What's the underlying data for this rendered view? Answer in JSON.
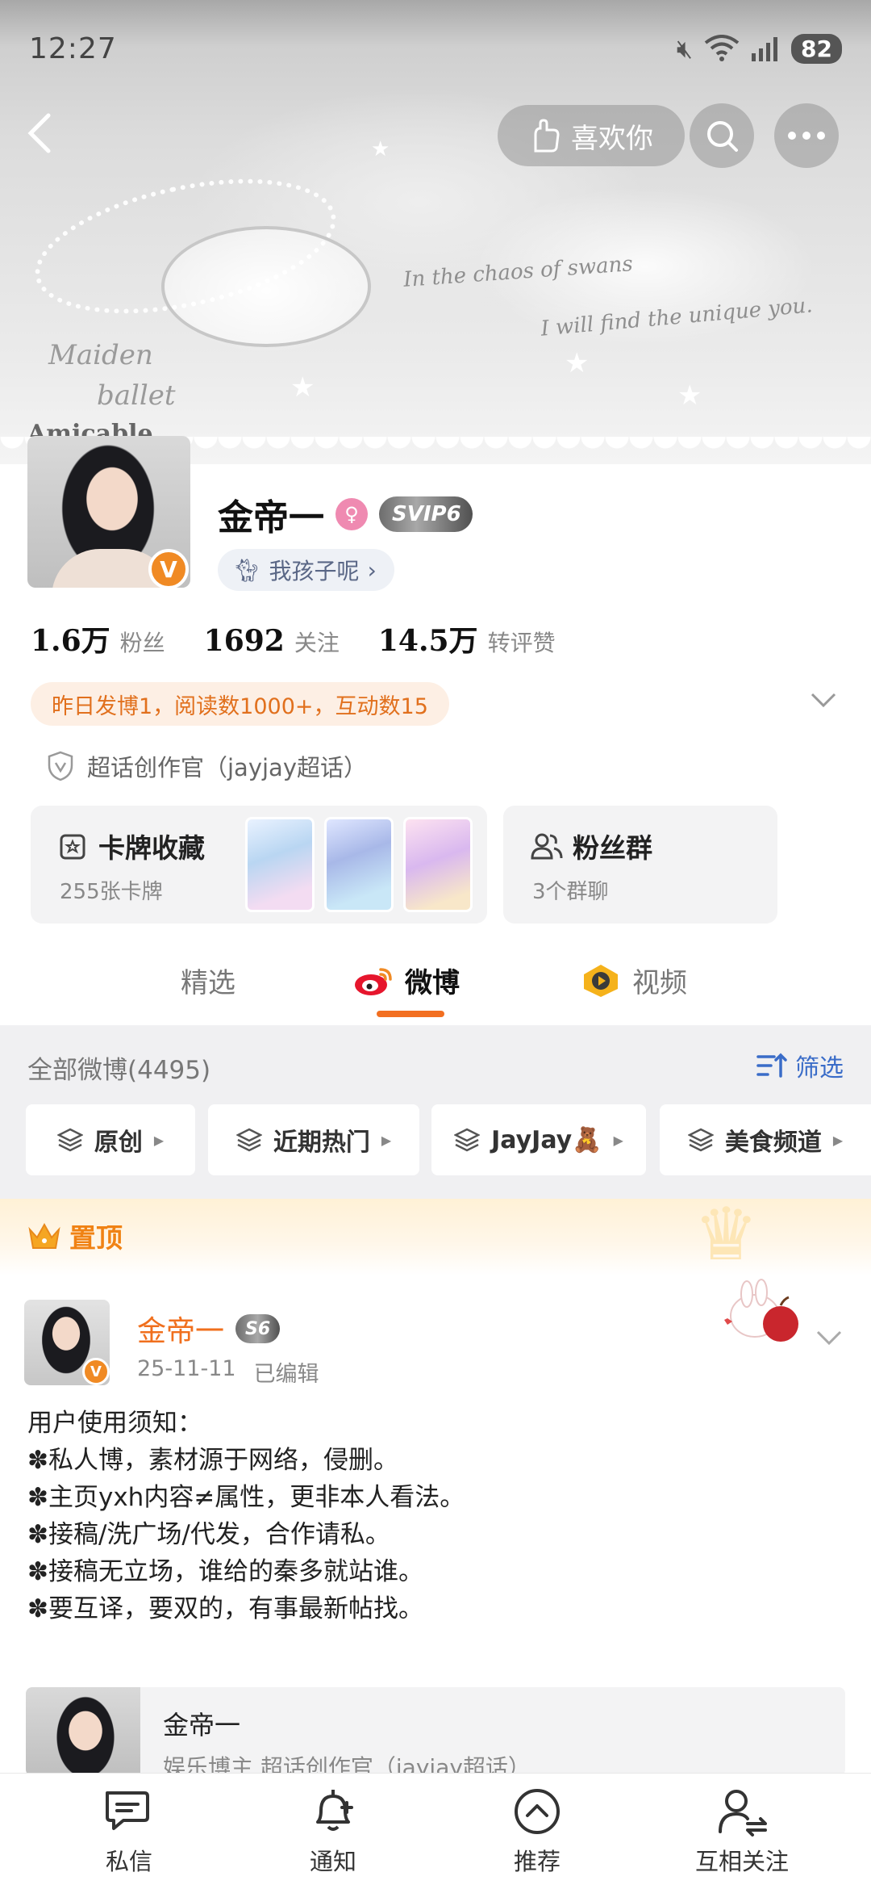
{
  "status_bar": {
    "time": "12:27",
    "battery": "82"
  },
  "header": {
    "like_label": "喜欢你"
  },
  "banner": {
    "texts": [
      "Maiden",
      "ballet",
      "Amicable",
      "In the chaos of swans",
      "I will find the unique you."
    ]
  },
  "profile": {
    "name": "金帝一",
    "vip_badge": "SVIP6",
    "tag": "我孩子呢",
    "stats": [
      {
        "value": "1.6万",
        "label": "粉丝"
      },
      {
        "value": "1692",
        "label": "关注"
      },
      {
        "value": "14.5万",
        "label": "转评赞"
      }
    ],
    "activity": "昨日发博1，阅读数1000+，互动数15",
    "creator": "超话创作官（jayjay超话）"
  },
  "cards": {
    "collection_title": "卡牌收藏",
    "collection_sub": "255张卡牌",
    "fans_title": "粉丝群",
    "fans_sub": "3个群聊"
  },
  "tabs": [
    {
      "label": "精选"
    },
    {
      "label": "微博"
    },
    {
      "label": "视频"
    }
  ],
  "feed": {
    "count_label": "全部微博(4495)",
    "filter_label": "筛选",
    "chips": [
      "原创",
      "近期热门",
      "JayJay🧸",
      "美食频道"
    ]
  },
  "pinned": {
    "label": "置顶",
    "author": "金帝一",
    "level_badge": "S6",
    "date": "25-11-11",
    "edited": "已编辑",
    "lines": [
      "用户使用须知：",
      "✽私人博，素材源于网络，侵删。",
      "✽主页yxh内容≠属性，更非本人看法。",
      "✽接稿/洗广场/代发，合作请私。",
      "✽接稿无立场，谁给的秦多就站谁。",
      "✽要互译，要双的，有事最新帖找。"
    ]
  },
  "quote": {
    "name": "金帝一",
    "sub": "娱乐博主 超话创作官（jayjay超话）"
  },
  "bottom_nav": [
    {
      "label": "私信",
      "icon": "message-icon"
    },
    {
      "label": "通知",
      "icon": "bell-add-icon"
    },
    {
      "label": "推荐",
      "icon": "up-circle-icon"
    },
    {
      "label": "互相关注",
      "icon": "mutual-follow-icon"
    }
  ],
  "colors": {
    "accent_orange": "#f26f21",
    "link_blue": "#3a6cc8",
    "pinned_orange": "#f08214"
  }
}
